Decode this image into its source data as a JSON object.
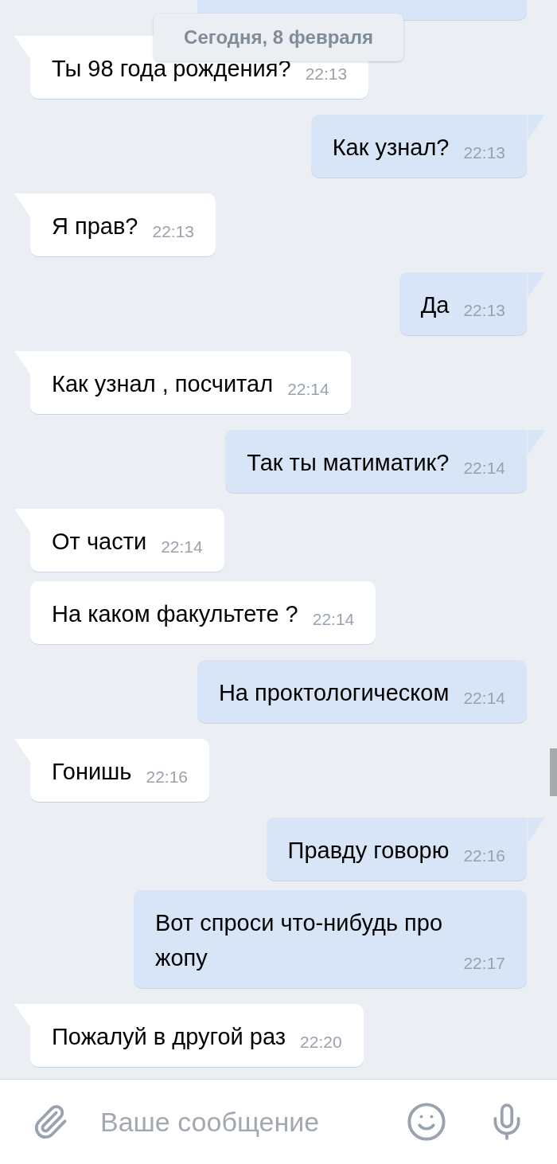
{
  "date_label": "Сегодня, 8 февраля",
  "messages": [
    {
      "kind": "in",
      "tail": true,
      "text": "Ты 98 года рождения?",
      "time": "22:13"
    },
    {
      "kind": "out",
      "tail": true,
      "text": "Как узнал?",
      "time": "22:13"
    },
    {
      "kind": "in",
      "tail": true,
      "text": "Я прав?",
      "time": "22:13"
    },
    {
      "kind": "out",
      "tail": true,
      "text": "Да",
      "time": "22:13"
    },
    {
      "kind": "in",
      "tail": true,
      "text": "Как узнал , посчитал",
      "time": "22:14"
    },
    {
      "kind": "out",
      "tail": true,
      "text": "Так ты матиматик?",
      "time": "22:14"
    },
    {
      "kind": "in",
      "tail": true,
      "text": "От части",
      "time": "22:14"
    },
    {
      "kind": "in",
      "tail": false,
      "text": "На каком факультете ?",
      "time": "22:14"
    },
    {
      "kind": "out",
      "tail": false,
      "text": "На проктологическом",
      "time": "22:14"
    },
    {
      "kind": "in",
      "tail": true,
      "text": "Гонишь",
      "time": "22:16"
    },
    {
      "kind": "out",
      "tail": true,
      "text": "Правду говорю",
      "time": "22:16"
    },
    {
      "kind": "out",
      "tail": false,
      "text": "Вот спроси что-нибудь про жопу",
      "time": "22:17"
    },
    {
      "kind": "in",
      "tail": true,
      "text": "Пожалуй в другой раз",
      "time": "22:20"
    }
  ],
  "composer": {
    "placeholder": "Ваше сообщение"
  }
}
